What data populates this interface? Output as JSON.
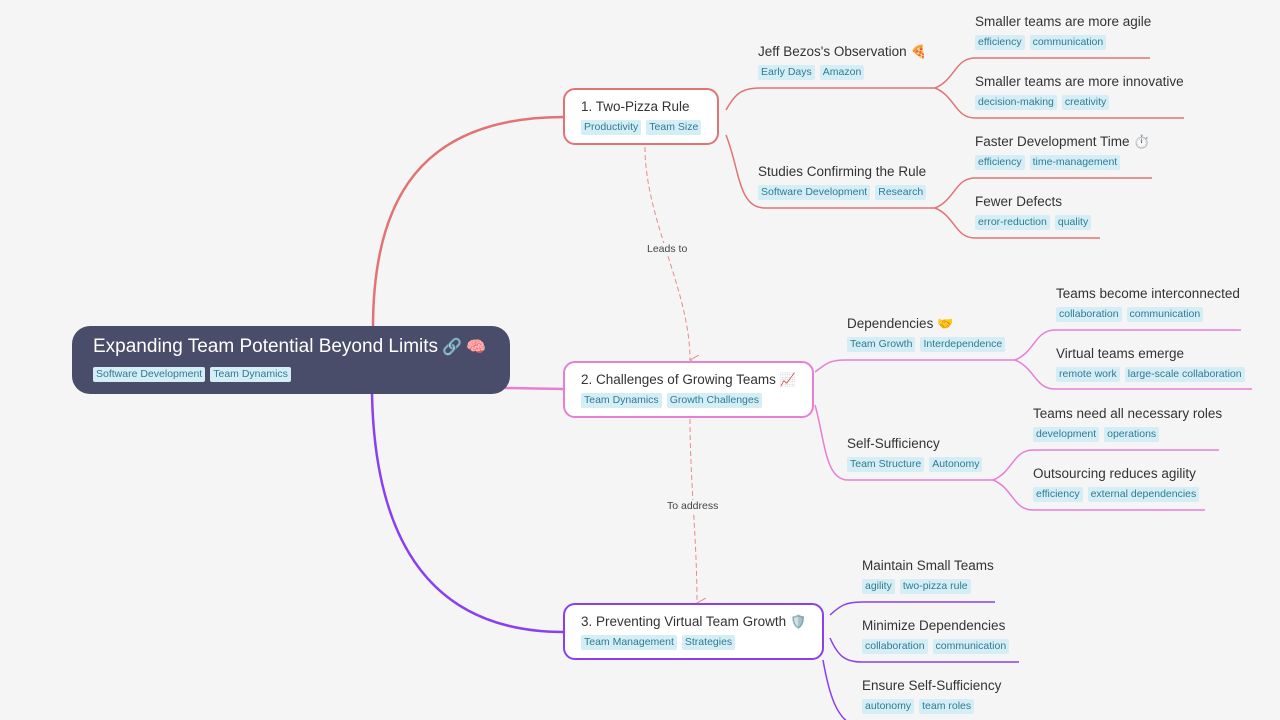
{
  "colors": {
    "branch1": "#e07474",
    "branch2": "#e77fd3",
    "branch3": "#8a3ff0",
    "root_bg": "#4a4d69",
    "relation": "#e88a8a",
    "background": "#f5f5f6",
    "tag_bg": "#d5eef6",
    "tag_text": "#2e7b93"
  },
  "root": {
    "title": "Expanding Team Potential Beyond Limits",
    "icons": [
      "link-icon",
      "brain-icon"
    ],
    "icon_glyphs": "🔗 🧠",
    "tags": [
      "Software Development",
      "Team Dynamics"
    ]
  },
  "branches": [
    {
      "title": "1. Two-Pizza Rule",
      "tags": [
        "Productivity",
        "Team Size"
      ],
      "children": [
        {
          "title": "Jeff Bezos's Observation",
          "icon": "pizza-icon",
          "icon_glyph": "🍕",
          "tags": [
            "Early Days",
            "Amazon"
          ],
          "children": [
            {
              "title": "Smaller teams are more agile",
              "tags": [
                "efficiency",
                "communication"
              ]
            },
            {
              "title": "Smaller teams are more innovative",
              "tags": [
                "decision-making",
                "creativity"
              ]
            }
          ]
        },
        {
          "title": "Studies Confirming the Rule",
          "tags": [
            "Software Development",
            "Research"
          ],
          "children": [
            {
              "title": "Faster Development Time",
              "icon": "stopwatch-icon",
              "icon_glyph": "⏱️",
              "tags": [
                "efficiency",
                "time-management"
              ]
            },
            {
              "title": "Fewer Defects",
              "tags": [
                "error-reduction",
                "quality"
              ]
            }
          ]
        }
      ]
    },
    {
      "title": "2. Challenges of Growing Teams",
      "icon": "chart-increasing-icon",
      "icon_glyph": "📈",
      "tags": [
        "Team Dynamics",
        "Growth Challenges"
      ],
      "children": [
        {
          "title": "Dependencies",
          "icon": "handshake-icon",
          "icon_glyph": "🤝",
          "tags": [
            "Team Growth",
            "Interdependence"
          ],
          "children": [
            {
              "title": "Teams become interconnected",
              "tags": [
                "collaboration",
                "communication"
              ]
            },
            {
              "title": "Virtual teams emerge",
              "tags": [
                "remote work",
                "large-scale collaboration"
              ]
            }
          ]
        },
        {
          "title": "Self-Sufficiency",
          "tags": [
            "Team Structure",
            "Autonomy"
          ],
          "children": [
            {
              "title": "Teams need all necessary roles",
              "tags": [
                "development",
                "operations"
              ]
            },
            {
              "title": "Outsourcing reduces agility",
              "tags": [
                "efficiency",
                "external dependencies"
              ]
            }
          ]
        }
      ]
    },
    {
      "title": "3. Preventing Virtual Team Growth",
      "icon": "shield-icon",
      "icon_glyph": "🛡️",
      "tags": [
        "Team Management",
        "Strategies"
      ],
      "children": [
        {
          "title": "Maintain Small Teams",
          "tags": [
            "agility",
            "two-pizza rule"
          ]
        },
        {
          "title": "Minimize Dependencies",
          "tags": [
            "collaboration",
            "communication"
          ]
        },
        {
          "title": "Ensure Self-Sufficiency",
          "tags": [
            "autonomy",
            "team roles"
          ]
        }
      ]
    }
  ],
  "relations": [
    {
      "from": "1. Two-Pizza Rule",
      "to": "2. Challenges of Growing Teams",
      "label": "Leads to"
    },
    {
      "from": "2. Challenges of Growing Teams",
      "to": "3. Preventing Virtual Team Growth",
      "label": "To address"
    }
  ]
}
